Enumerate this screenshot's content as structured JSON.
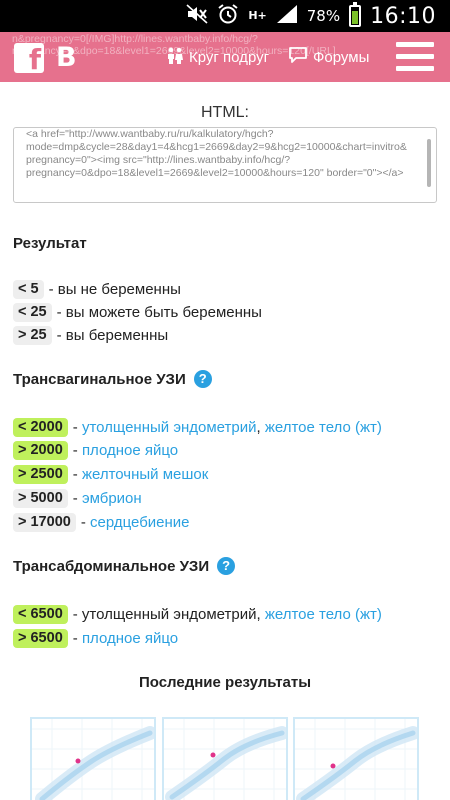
{
  "status_bar": {
    "battery": "78%",
    "time": "16:10",
    "network": "H+",
    "icons": [
      "mute-icon",
      "alarm-icon",
      "network-hplus-icon",
      "signal-icon",
      "battery-icon"
    ]
  },
  "header": {
    "ghost_text_1": "n&pregnancy=0[/IMG]http://lines.wantbaby.info/hcg/?",
    "ghost_text_2": "nregnancy=0&dpo=18&level1=2669&level2=10000&hours=120[/URL]",
    "facebook_label": "f",
    "vk_label": "B",
    "circle_label": "Круг подруг",
    "forum_label": "Форумы",
    "bg_color": "#e6718d"
  },
  "embed": {
    "label": "HTML:",
    "code": "<a href=\"http://www.wantbaby.ru/ru/kalkulatory/hgch?mode=dmp&cycle=28&day1=4&hcg1=2669&day2=9&hcg2=10000&chart=invitro&pregnancy=0\"><img src=\"http://lines.wantbaby.info/hcg/?pregnancy=0&dpo=18&level1=2669&level2=10000&hours=120\" border=\"0\"></a>"
  },
  "result": {
    "title": "Результат",
    "rows": [
      {
        "badge": "< 5",
        "text": "- вы не беременны"
      },
      {
        "badge": "< 25",
        "text": "- вы можете быть беременны"
      },
      {
        "badge": "> 25",
        "text": "- вы беременны"
      }
    ]
  },
  "transvaginal": {
    "title": "Трансвагинальное УЗИ",
    "rows": [
      {
        "badge": "< 2000",
        "dash": "-",
        "link1": "утолщенный эндометрий",
        "sep": ",",
        "link2": "желтое тело (жт)"
      },
      {
        "badge": "> 2000",
        "dash": "-",
        "link1": "плодное яйцо"
      },
      {
        "badge": "> 2500",
        "dash": "-",
        "link1": "желточный мешок"
      },
      {
        "badge": "> 5000",
        "dash": "-",
        "link1": "эмбрион"
      },
      {
        "badge": "> 17000",
        "dash": "-",
        "link1": "сердцебиение"
      }
    ]
  },
  "transabdominal": {
    "title": "Трансабдоминальное УЗИ",
    "rows": [
      {
        "badge": "< 6500",
        "dash": "- утолщенный эндометрий,",
        "link2": "желтое тело (жт)"
      },
      {
        "badge": "> 6500",
        "dash": "-",
        "link1": "плодное яйцо"
      }
    ]
  },
  "recent": {
    "title": "Последние результаты",
    "thumb_count": 3
  },
  "colors": {
    "accent": "#2aa0e0",
    "badge_green": "#bff05c",
    "badge_grey": "#eeeeee"
  }
}
